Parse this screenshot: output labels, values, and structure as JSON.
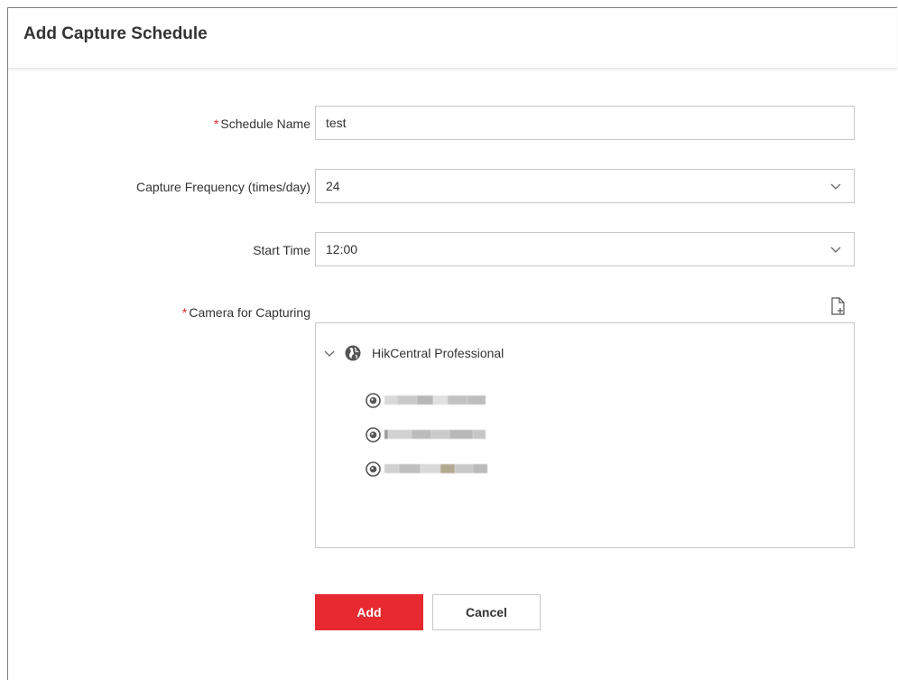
{
  "dialog": {
    "title": "Add Capture Schedule"
  },
  "form": {
    "schedule_name": {
      "label": "Schedule Name",
      "required_mark": "*",
      "value": "test"
    },
    "capture_frequency": {
      "label": "Capture Frequency (times/day)",
      "value": "24"
    },
    "start_time": {
      "label": "Start Time",
      "value": "12:00"
    },
    "camera": {
      "label": "Camera for Capturing",
      "required_mark": "*"
    }
  },
  "tree": {
    "root_label": "HikCentral Professional",
    "cameras_redacted": 3
  },
  "buttons": {
    "add": "Add",
    "cancel": "Cancel"
  },
  "colors": {
    "accent": "#e62a30",
    "required": "#e8272b",
    "border": "#c8c8c8"
  },
  "icons": [
    "chevron-down-icon",
    "import-file-icon",
    "expand-chevron-icon",
    "globe-icon",
    "camera-icon"
  ]
}
